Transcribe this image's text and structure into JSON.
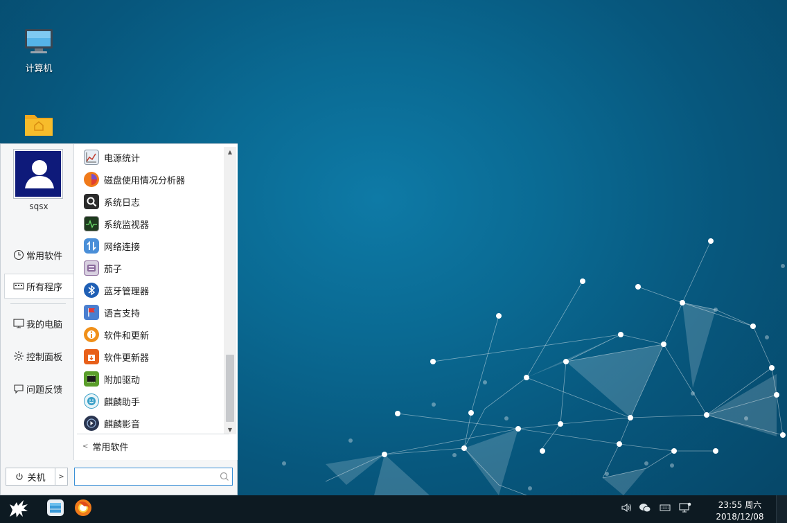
{
  "desktop": {
    "icons": [
      {
        "label": "计算机",
        "icon": "computer-icon"
      },
      {
        "label": "",
        "icon": "home-folder-icon"
      }
    ]
  },
  "start_menu": {
    "user": {
      "name": "sqsx",
      "avatar": "user-avatar-icon"
    },
    "nav": [
      {
        "label": "常用软件",
        "icon": "clock-icon",
        "active": false
      },
      {
        "label": "所有程序",
        "icon": "all-programs-icon",
        "active": true
      },
      {
        "label": "我的电脑",
        "icon": "monitor-icon",
        "active": false
      },
      {
        "label": "控制面板",
        "icon": "gear-icon",
        "active": false
      },
      {
        "label": "问题反馈",
        "icon": "feedback-icon",
        "active": false
      }
    ],
    "apps": [
      {
        "label": "电源统计",
        "icon": "power-statistics-icon",
        "color": "#e8eef5"
      },
      {
        "label": "磁盘使用情况分析器",
        "icon": "disk-usage-icon",
        "color": "#f07a1a"
      },
      {
        "label": "系统日志",
        "icon": "system-log-icon",
        "color": "#2b2b2b"
      },
      {
        "label": "系统监视器",
        "icon": "system-monitor-icon",
        "color": "#1e3a1e"
      },
      {
        "label": "网络连接",
        "icon": "network-icon",
        "color": "#4a8fd8"
      },
      {
        "label": "茄子",
        "icon": "cheese-icon",
        "color": "#8b6b9c"
      },
      {
        "label": "蓝牙管理器",
        "icon": "bluetooth-icon",
        "color": "#1f5fb5"
      },
      {
        "label": "语言支持",
        "icon": "language-support-icon",
        "color": "#4a7fd0"
      },
      {
        "label": "软件和更新",
        "icon": "software-update-icon",
        "color": "#f0901a"
      },
      {
        "label": "软件更新器",
        "icon": "software-updater-icon",
        "color": "#e8601a"
      },
      {
        "label": "附加驱动",
        "icon": "driver-icon",
        "color": "#5a9e2a"
      },
      {
        "label": "麒麟助手",
        "icon": "kylin-assistant-icon",
        "color": "#3aa0c8"
      },
      {
        "label": "麒麟影音",
        "icon": "kylin-video-icon",
        "color": "#2a3550"
      }
    ],
    "back_label": "常用软件",
    "power_label": "关机",
    "search": {
      "value": "",
      "placeholder": ""
    }
  },
  "taskbar": {
    "start_icon": "kylin-logo-icon",
    "pinned": [
      {
        "icon": "file-manager-icon"
      },
      {
        "icon": "firefox-icon"
      }
    ],
    "tray": [
      "volume-icon",
      "wechat-icon",
      "keyboard-icon",
      "network-status-icon"
    ],
    "clock": {
      "time": "23:55 周六",
      "date": "2018/12/08"
    }
  }
}
